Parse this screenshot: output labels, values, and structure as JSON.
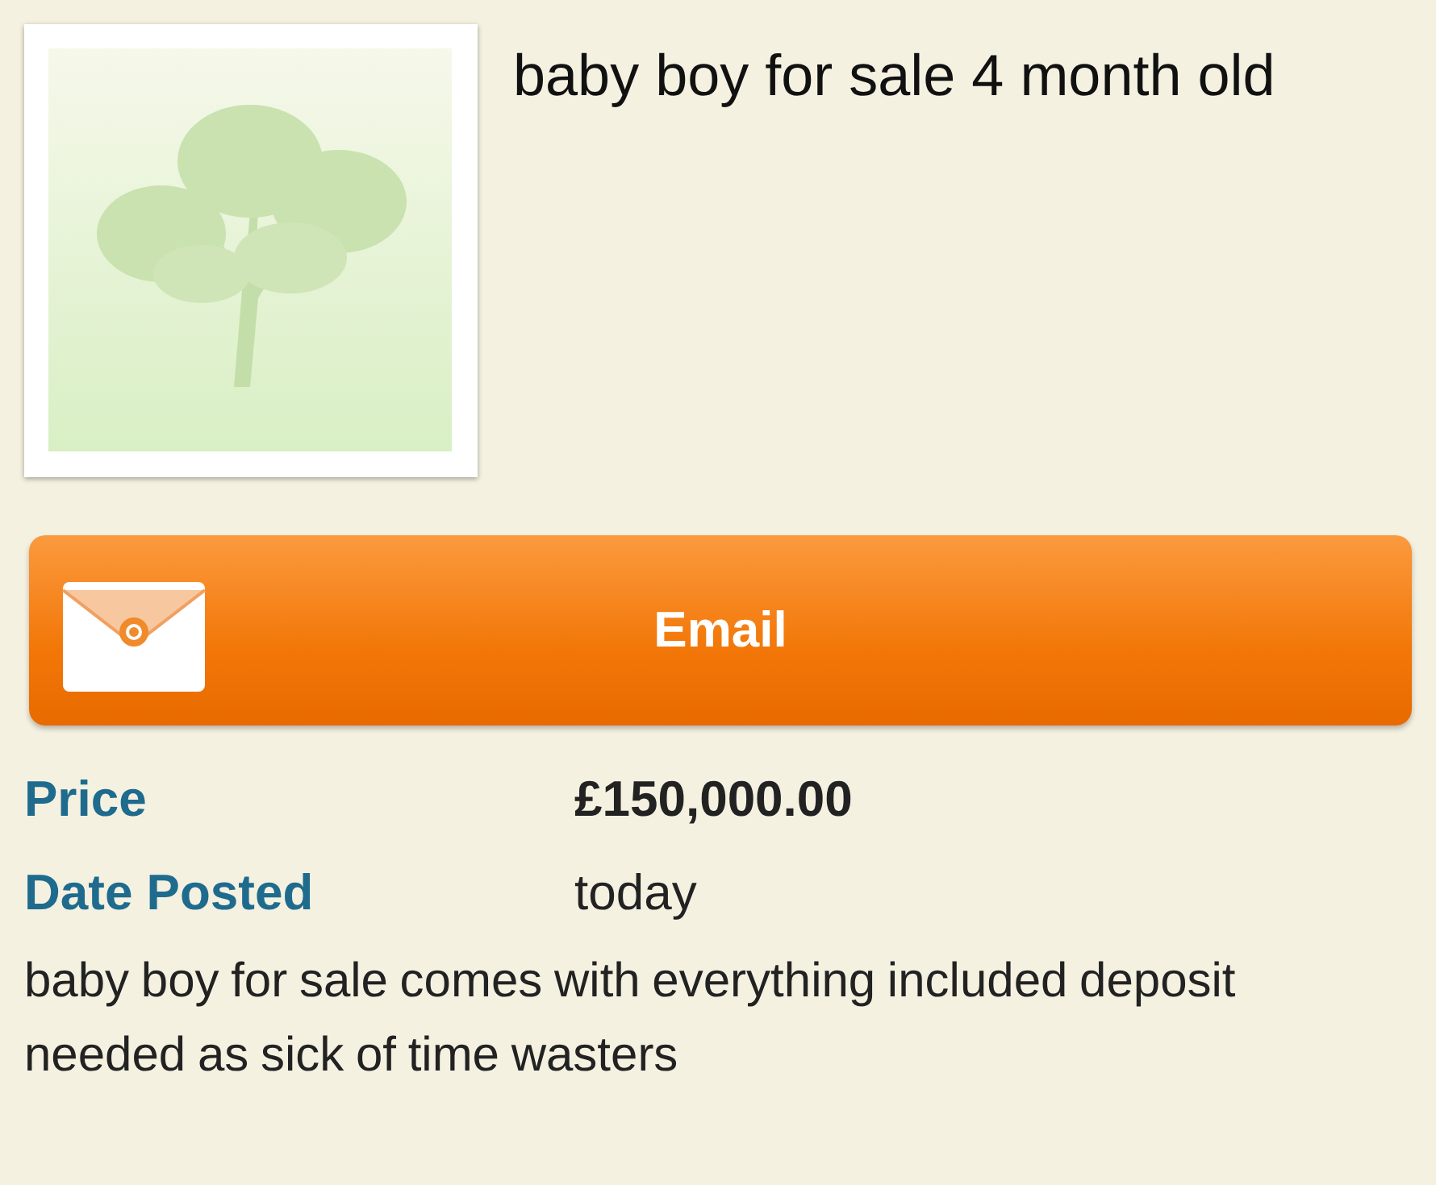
{
  "listing": {
    "title": "baby boy for sale 4 month old"
  },
  "email_button": {
    "label": "Email"
  },
  "details": [
    {
      "label": "Price",
      "value": "£150,000.00",
      "emphasis": true
    },
    {
      "label": "Date Posted",
      "value": "today",
      "emphasis": false
    }
  ],
  "description": "baby boy for sale comes with everything included deposit needed as sick of time wasters"
}
